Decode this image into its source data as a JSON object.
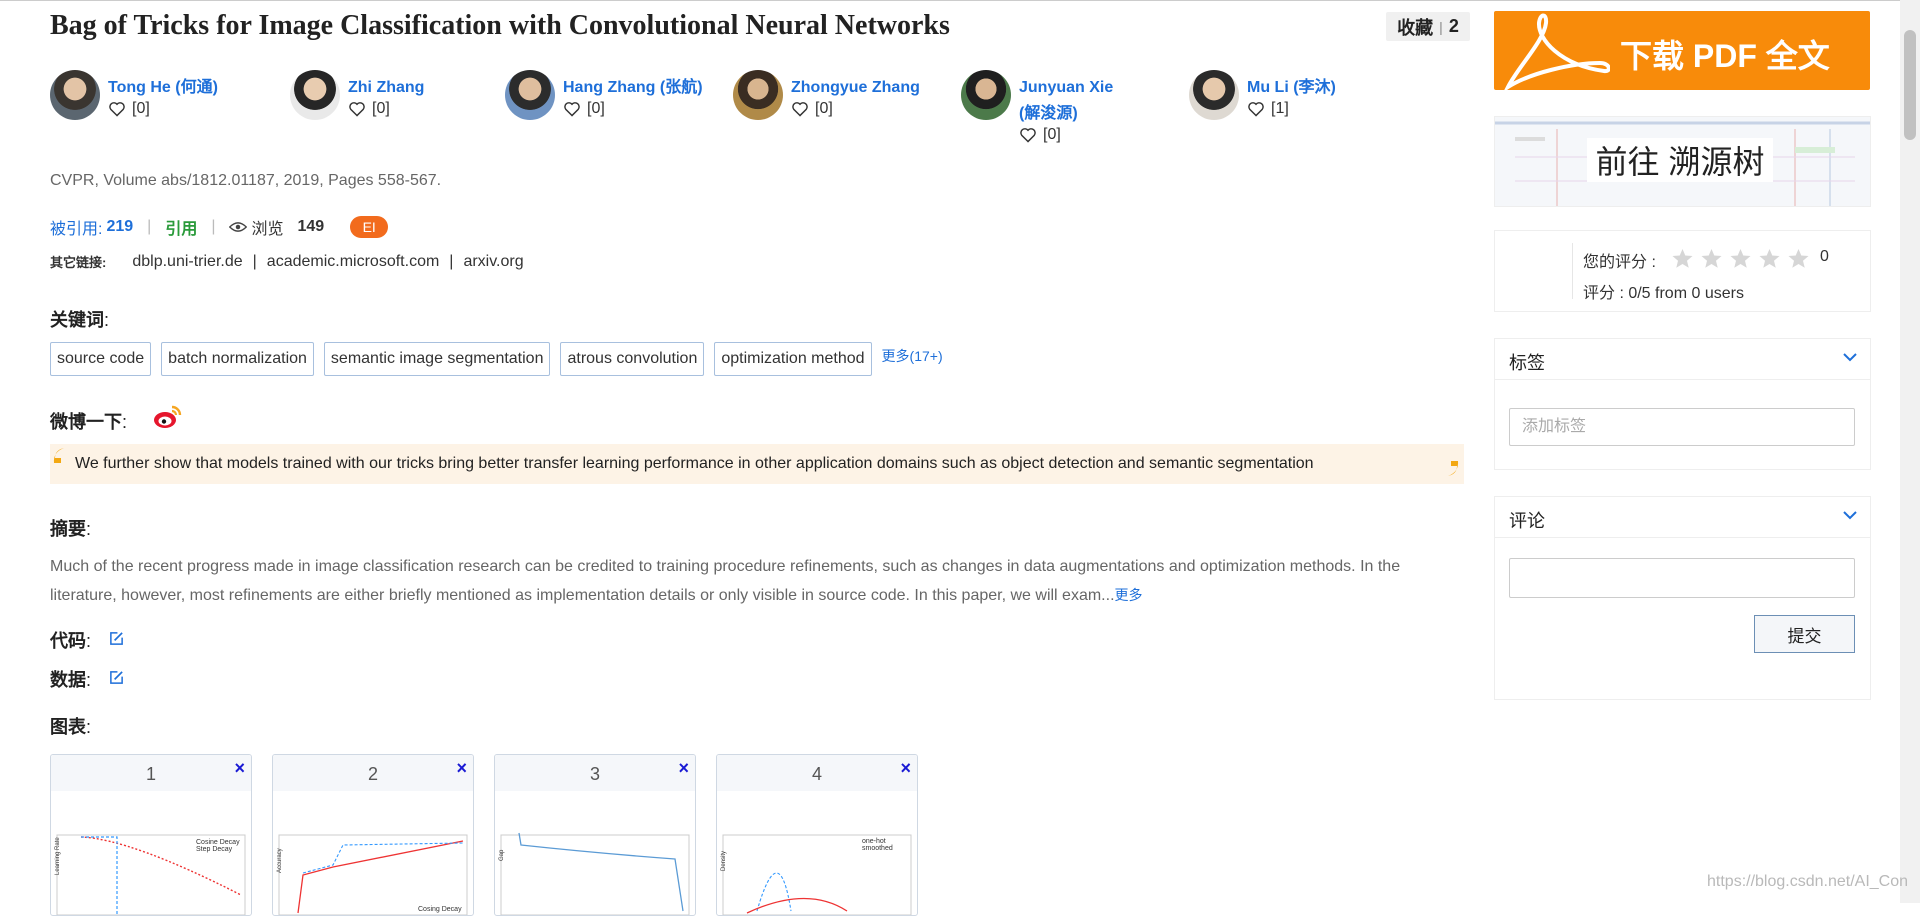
{
  "paper": {
    "title": "Bag of Tricks for Image Classification with Convolutional Neural Networks",
    "collect_label": "收藏",
    "collect_separator": "|",
    "collect_count": "2",
    "venue": "CVPR, Volume abs/1812.01187, 2019, Pages 558-567."
  },
  "authors": [
    {
      "name": "Tong He (何通)",
      "likes": "[0]"
    },
    {
      "name": "Zhi Zhang",
      "likes": "[0]"
    },
    {
      "name": "Hang Zhang (张航)",
      "likes": "[0]"
    },
    {
      "name": "Zhongyue Zhang",
      "likes": "[0]"
    },
    {
      "name": "Junyuan Xie (解浚源)",
      "likes": "[0]"
    },
    {
      "name": "Mu Li (李沐)",
      "likes": "[1]"
    }
  ],
  "stats": {
    "cited_label": "被引用:",
    "cited_count": "219",
    "separator": "|",
    "cite_button": "引用",
    "views_label": "浏览",
    "views_count": "149",
    "badge": "EI"
  },
  "links": {
    "label": "其它链接:",
    "items": [
      "dblp.uni-trier.de",
      "academic.microsoft.com",
      "arxiv.org"
    ],
    "separator": "|"
  },
  "keywords": {
    "label": "关键词",
    "items": [
      "source code",
      "batch normalization",
      "semantic image segmentation",
      "atrous convolution",
      "optimization method"
    ],
    "more": "更多(17+)"
  },
  "weibo": {
    "label": "微博一下",
    "quote": "We further show that models trained with our tricks bring better transfer learning performance in other application domains such as object detection and semantic segmentation"
  },
  "abstract": {
    "label": "摘要",
    "text": "Much of the recent progress made in image classification research can be credited to training procedure refinements, such as changes in data augmentations and optimization methods. In the literature, however, most refinements are either briefly mentioned as implementation details or only visible in source code. In this paper, we will exam...",
    "more": "更多"
  },
  "code": {
    "label": "代码"
  },
  "data": {
    "label": "数据"
  },
  "colon": ":",
  "figures": {
    "label": "图表",
    "close_symbol": "×",
    "items": [
      {
        "number": "1",
        "legend": [
          "Cosine Decay",
          "Step Decay"
        ],
        "axis_label": "Learning Rate"
      },
      {
        "number": "2",
        "legend": [
          "Cosing Decay"
        ],
        "axis_label": "Accuracy"
      },
      {
        "number": "3",
        "legend": [],
        "axis_label": "Gap"
      },
      {
        "number": "4",
        "legend": [
          "one-hot",
          "smoothed"
        ],
        "axis_label": "Density"
      }
    ]
  },
  "sidebar": {
    "pdf_button": "下载 PDF 全文",
    "tree_button": "前往 溯源树",
    "rating": {
      "your_rating_label": "您的评分 :",
      "stars_total": 5,
      "stars_filled": 0,
      "value": "0",
      "summary": "评分 : 0/5 from 0 users"
    },
    "tags": {
      "title": "标签",
      "placeholder": "添加标签"
    },
    "comments": {
      "title": "评论",
      "value": "",
      "submit": "提交"
    }
  },
  "watermark": "https://blog.csdn.net/AI_Con",
  "colors": {
    "link_blue": "#1e6fd9",
    "cite_green": "#2a9a3a",
    "pdf_orange": "#f88b0a",
    "ei_orange": "#f26b1d",
    "quote_bg": "#fdf3e6",
    "quote_mark": "#f3a812",
    "weibo_red": "#e6162d"
  }
}
